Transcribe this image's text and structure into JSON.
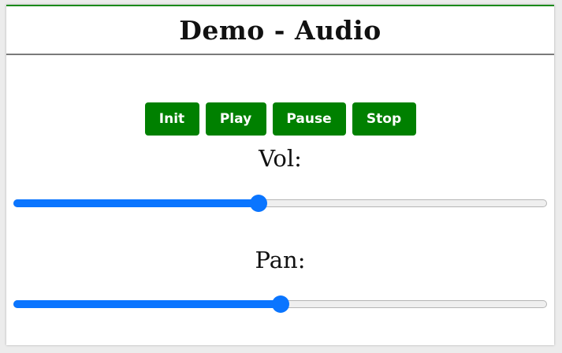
{
  "header": {
    "title": "Demo - Audio"
  },
  "controls": {
    "init_label": "Init",
    "play_label": "Play",
    "pause_label": "Pause",
    "stop_label": "Stop"
  },
  "volume": {
    "label": "Vol:",
    "value_fraction": 0.46
  },
  "pan": {
    "label": "Pan:",
    "value_fraction": 0.5
  },
  "colors": {
    "accent": "#0a75ff",
    "button_bg": "#008000",
    "button_text": "#ffffff"
  }
}
